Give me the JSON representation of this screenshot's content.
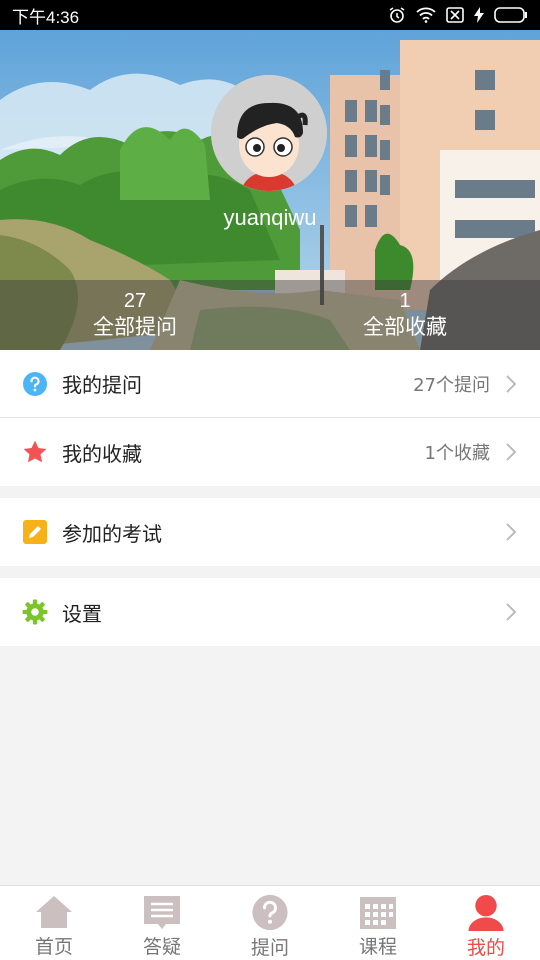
{
  "status_bar": {
    "time": "下午4:36",
    "icons": [
      "alarm-icon",
      "wifi-icon",
      "sim-icon",
      "charging-icon",
      "battery-icon"
    ]
  },
  "profile": {
    "username": "yuanqiwu",
    "stats": [
      {
        "count": "27",
        "label": "全部提问"
      },
      {
        "count": "1",
        "label": "全部收藏"
      }
    ]
  },
  "menu": {
    "my_questions": {
      "label": "我的提问",
      "value": "27个提问",
      "icon": "question-icon",
      "icon_color": "#4cb5f5"
    },
    "my_favorites": {
      "label": "我的收藏",
      "value": "1个收藏",
      "icon": "star-icon",
      "icon_color": "#f25454"
    },
    "my_exams": {
      "label": "参加的考试",
      "icon": "pencil-icon",
      "icon_color": "#f7b21a"
    },
    "settings": {
      "label": "设置",
      "icon": "gear-icon",
      "icon_color": "#7bc42a"
    }
  },
  "bottom_nav": {
    "items": [
      {
        "label": "首页",
        "icon": "home-icon"
      },
      {
        "label": "答疑",
        "icon": "list-icon"
      },
      {
        "label": "提问",
        "icon": "question-icon"
      },
      {
        "label": "课程",
        "icon": "calendar-icon"
      },
      {
        "label": "我的",
        "icon": "person-icon"
      }
    ],
    "active_index": 4,
    "active_color": "#f04a4a",
    "inactive_color": "#cbbfbf"
  }
}
